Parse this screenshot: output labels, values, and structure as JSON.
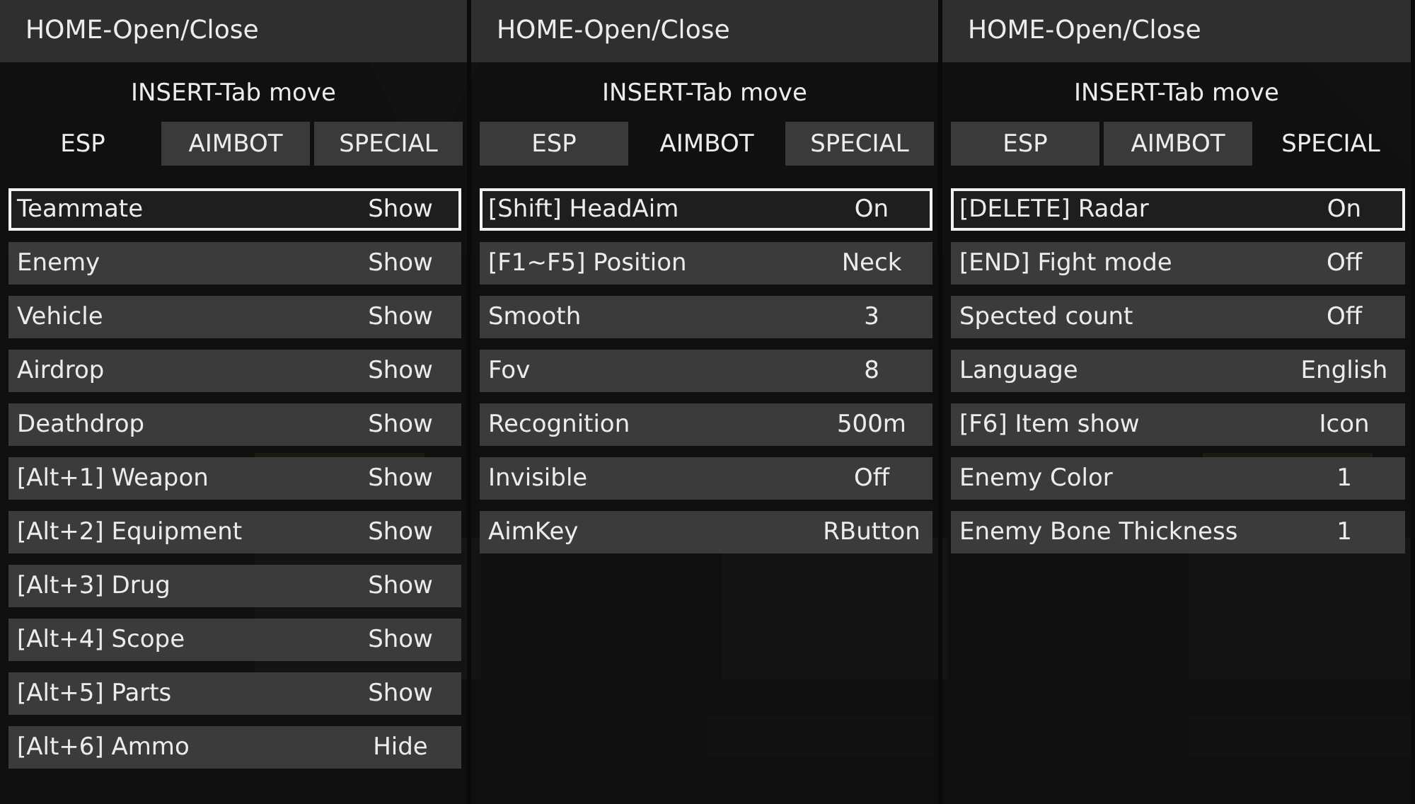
{
  "panels": [
    {
      "title": "HOME-Open/Close",
      "hint": "INSERT-Tab move",
      "tabs": [
        {
          "label": "ESP",
          "selected": true
        },
        {
          "label": "AIMBOT",
          "selected": false
        },
        {
          "label": "SPECIAL",
          "selected": false
        }
      ],
      "rows": [
        {
          "label": "Teammate",
          "value": "Show",
          "selected": true
        },
        {
          "label": "Enemy",
          "value": "Show",
          "selected": false
        },
        {
          "label": "Vehicle",
          "value": "Show",
          "selected": false
        },
        {
          "label": "Airdrop",
          "value": "Show",
          "selected": false
        },
        {
          "label": "Deathdrop",
          "value": "Show",
          "selected": false
        },
        {
          "label": "[Alt+1] Weapon",
          "value": "Show",
          "selected": false
        },
        {
          "label": "[Alt+2] Equipment",
          "value": "Show",
          "selected": false
        },
        {
          "label": "[Alt+3] Drug",
          "value": "Show",
          "selected": false
        },
        {
          "label": "[Alt+4] Scope",
          "value": "Show",
          "selected": false
        },
        {
          "label": "[Alt+5] Parts",
          "value": "Show",
          "selected": false
        },
        {
          "label": "[Alt+6] Ammo",
          "value": "Hide",
          "selected": false
        }
      ]
    },
    {
      "title": "HOME-Open/Close",
      "hint": "INSERT-Tab move",
      "tabs": [
        {
          "label": "ESP",
          "selected": false
        },
        {
          "label": "AIMBOT",
          "selected": true
        },
        {
          "label": "SPECIAL",
          "selected": false
        }
      ],
      "rows": [
        {
          "label": "[Shift] HeadAim",
          "value": "On",
          "selected": true
        },
        {
          "label": "[F1~F5] Position",
          "value": "Neck",
          "selected": false
        },
        {
          "label": "Smooth",
          "value": "3",
          "selected": false
        },
        {
          "label": "Fov",
          "value": "8",
          "selected": false
        },
        {
          "label": "Recognition",
          "value": "500m",
          "selected": false
        },
        {
          "label": "Invisible",
          "value": "Off",
          "selected": false
        },
        {
          "label": "AimKey",
          "value": "RButton",
          "selected": false
        }
      ]
    },
    {
      "title": "HOME-Open/Close",
      "hint": "INSERT-Tab move",
      "tabs": [
        {
          "label": "ESP",
          "selected": false
        },
        {
          "label": "AIMBOT",
          "selected": false
        },
        {
          "label": "SPECIAL",
          "selected": true
        }
      ],
      "rows": [
        {
          "label": "[DELETE] Radar",
          "value": "On",
          "selected": true
        },
        {
          "label": "[END] Fight mode",
          "value": "Off",
          "selected": false
        },
        {
          "label": "Spected count",
          "value": "Off",
          "selected": false
        },
        {
          "label": "Language",
          "value": "English",
          "selected": false
        },
        {
          "label": "[F6] Item show",
          "value": "Icon",
          "selected": false
        },
        {
          "label": "Enemy Color",
          "value": "1",
          "selected": false
        },
        {
          "label": "Enemy Bone Thickness",
          "value": "1",
          "selected": false
        }
      ]
    }
  ]
}
